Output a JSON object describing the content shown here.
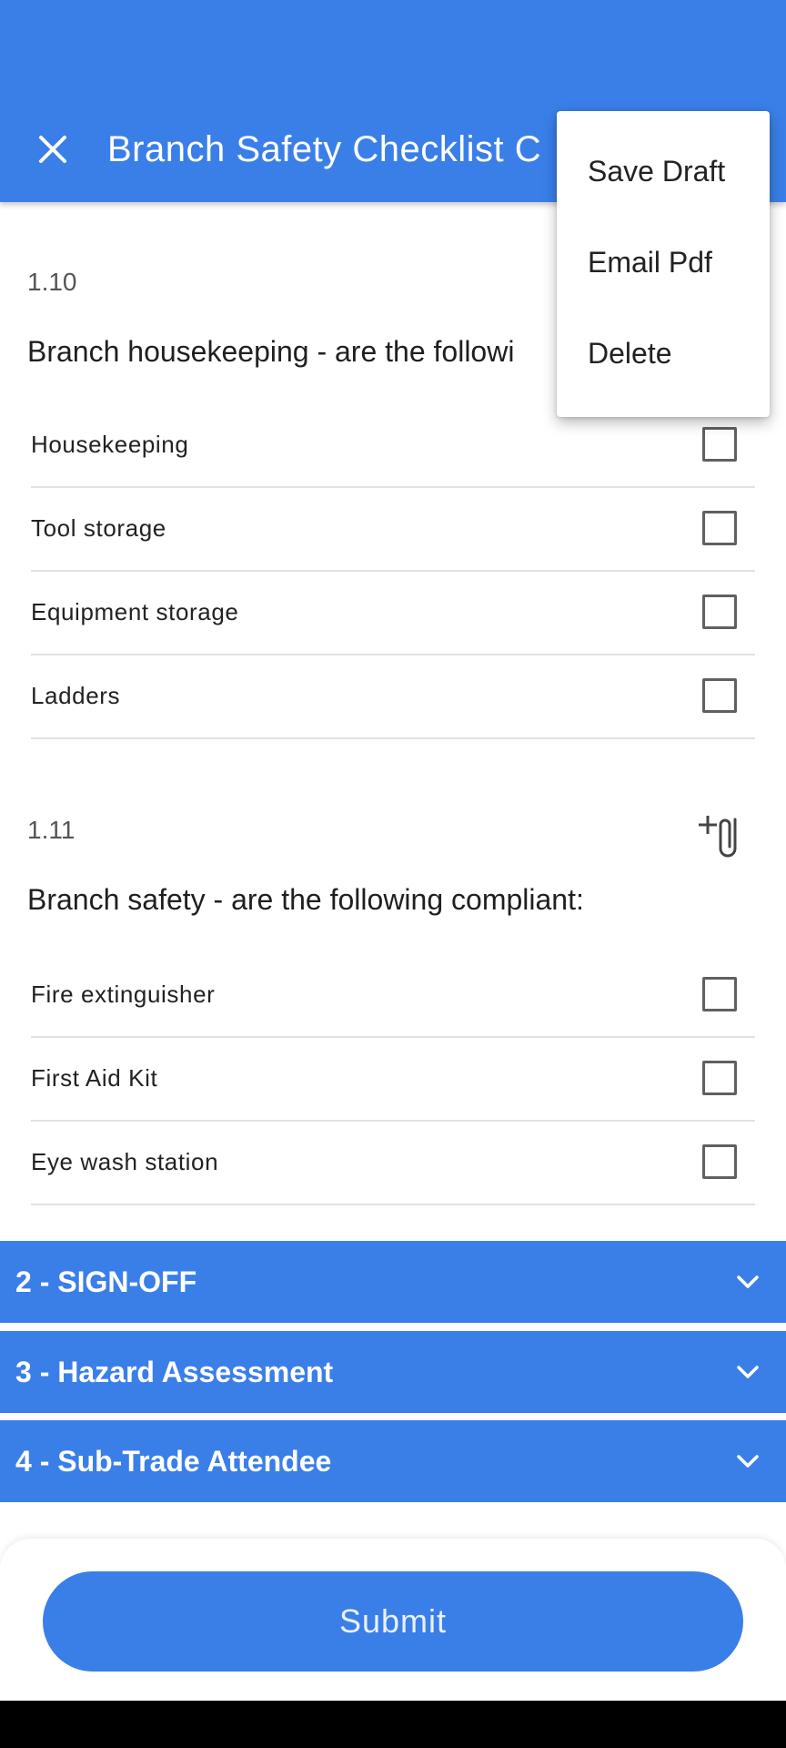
{
  "header": {
    "title": "Branch Safety Checklist C",
    "close_icon": "close-icon",
    "background": "#3a7fe8"
  },
  "menu": {
    "items": [
      {
        "label": "Save Draft"
      },
      {
        "label": "Email Pdf"
      },
      {
        "label": "Delete"
      }
    ]
  },
  "questions": [
    {
      "number": "1.10",
      "title": "Branch housekeeping - are the followi",
      "items": [
        {
          "label": "Housekeeping",
          "checked": false
        },
        {
          "label": "Tool storage",
          "checked": false
        },
        {
          "label": "Equipment storage",
          "checked": false
        },
        {
          "label": "Ladders",
          "checked": false
        }
      ]
    },
    {
      "number": "1.11",
      "title": "Branch safety - are the following compliant:",
      "attach_icon": "attach-add-icon",
      "items": [
        {
          "label": "Fire extinguisher",
          "checked": false
        },
        {
          "label": "First Aid Kit",
          "checked": false
        },
        {
          "label": "Eye wash station",
          "checked": false
        }
      ]
    }
  ],
  "sections": [
    {
      "label": "2 - SIGN-OFF",
      "icon": "chevron-down-icon"
    },
    {
      "label": "3 - Hazard Assessment",
      "icon": "chevron-down-icon"
    },
    {
      "label": "4 - Sub-Trade Attendee",
      "icon": "chevron-down-icon"
    }
  ],
  "footer": {
    "submit_label": "Submit"
  },
  "colors": {
    "accent": "#3a7fe8",
    "divider": "#e2e2e2",
    "nav_bar": "#000000"
  }
}
